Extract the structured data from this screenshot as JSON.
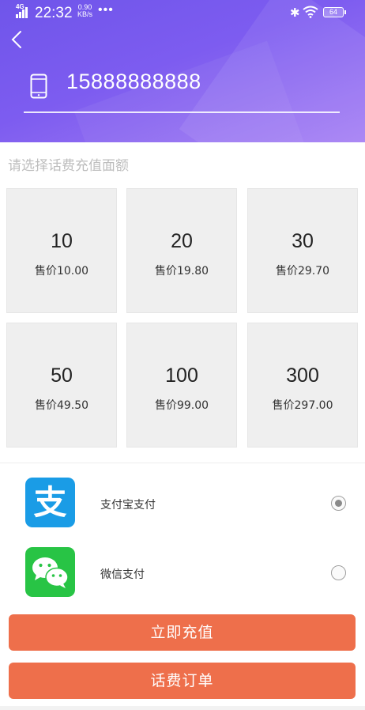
{
  "status_bar": {
    "network": "4G",
    "time": "22:32",
    "speed_value": "0.90",
    "speed_unit": "KB/s",
    "dots": "•••",
    "bluetooth_glyph": "✱",
    "battery": "64"
  },
  "header": {
    "back_icon": "chevron-left-icon",
    "phone_icon": "mobile-phone-icon",
    "phone_number": "15888888888",
    "gradient_from": "#6f55ea",
    "gradient_to": "#a57ff3"
  },
  "denomination_section": {
    "title": "请选择话费充值面额",
    "options": [
      {
        "amount": "10",
        "price": "售价10.00"
      },
      {
        "amount": "20",
        "price": "售价19.80"
      },
      {
        "amount": "30",
        "price": "售价29.70"
      },
      {
        "amount": "50",
        "price": "售价49.50"
      },
      {
        "amount": "100",
        "price": "售价99.00"
      },
      {
        "amount": "300",
        "price": "售价297.00"
      }
    ]
  },
  "payment": {
    "methods": [
      {
        "label": "支付宝支付",
        "icon": "alipay-logo-icon",
        "logo_glyph": "支",
        "color": "#1a9ce6",
        "selected": true
      },
      {
        "label": "微信支付",
        "icon": "wechat-logo-icon",
        "color": "#28c445",
        "selected": false
      }
    ]
  },
  "actions": {
    "recharge_label": "立即充值",
    "orders_label": "话费订单",
    "button_color": "#ee6f4b"
  }
}
